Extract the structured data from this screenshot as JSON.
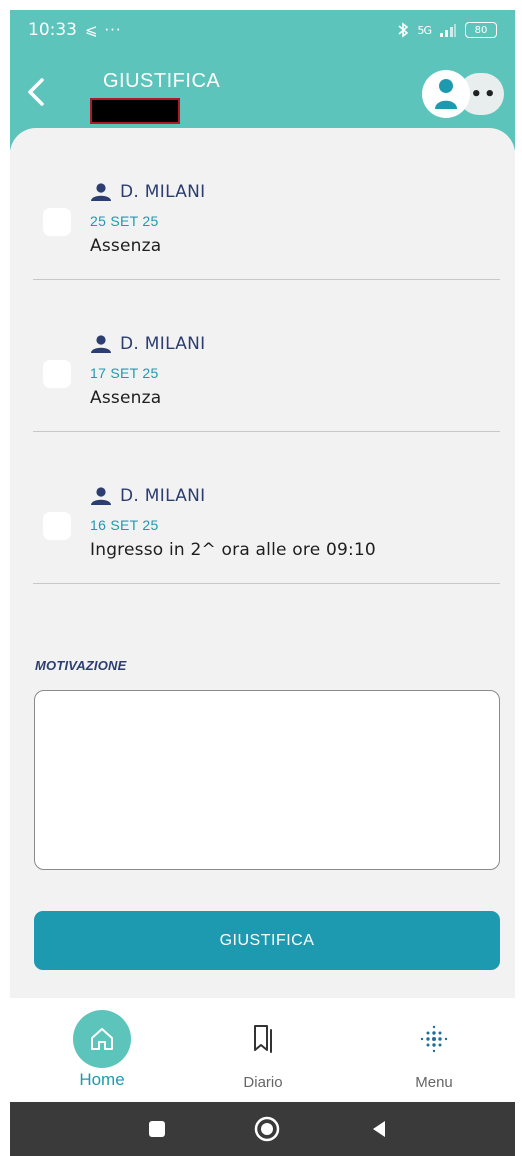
{
  "status_bar": {
    "time": "10:33",
    "left_icons": "⩽ ···",
    "network": "5G",
    "battery": "80"
  },
  "header": {
    "title": "GIUSTIFICA",
    "profile_more": "••"
  },
  "items": [
    {
      "teacher": "D. MILANI",
      "date": "25 SET 25",
      "description": "Assenza",
      "checked": false
    },
    {
      "teacher": "D. MILANI",
      "date": "17 SET 25",
      "description": "Assenza",
      "checked": false
    },
    {
      "teacher": "D. MILANI",
      "date": "16 SET 25",
      "description": "Ingresso in 2^ ora alle ore 09:10",
      "checked": false
    }
  ],
  "motivation": {
    "label": "MOTIVAZIONE",
    "value": ""
  },
  "submit_label": "GIUSTIFICA",
  "bottom_nav": [
    {
      "label": "Home",
      "icon": "home-icon",
      "active": true
    },
    {
      "label": "Diario",
      "icon": "bookmark-icon",
      "active": false
    },
    {
      "label": "Menu",
      "icon": "dots-grid-icon",
      "active": false
    }
  ],
  "colors": {
    "primary": "#5dc4bc",
    "accent": "#1e9ab0",
    "dark_text": "#2c3e6f",
    "background": "#f2f2f2"
  }
}
